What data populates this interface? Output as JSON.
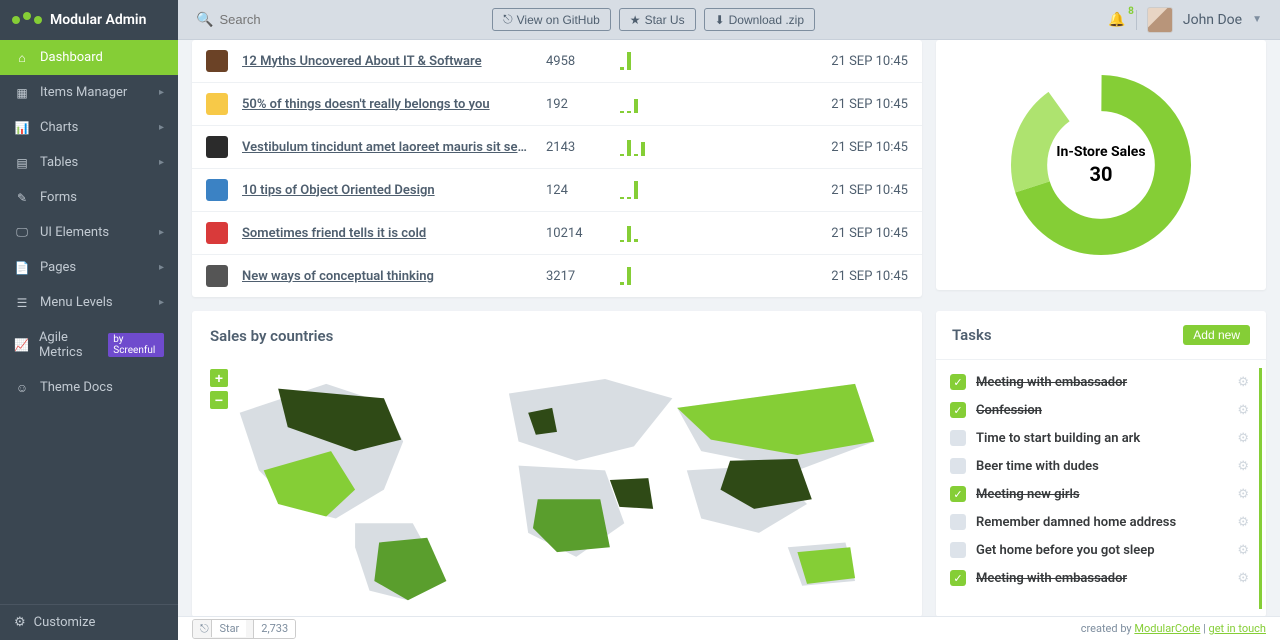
{
  "brand": "Modular Admin",
  "search_placeholder": "Search",
  "header_buttons": {
    "github": "View on GitHub",
    "star": "Star Us",
    "download": "Download .zip"
  },
  "notifications_count": "8",
  "user_name": "John Doe",
  "sidebar": [
    {
      "label": "Dashboard",
      "icon": "⌂",
      "active": true,
      "arrow": false
    },
    {
      "label": "Items Manager",
      "icon": "▦",
      "arrow": true
    },
    {
      "label": "Charts",
      "icon": "📊",
      "arrow": true
    },
    {
      "label": "Tables",
      "icon": "▤",
      "arrow": true
    },
    {
      "label": "Forms",
      "icon": "✎",
      "arrow": false
    },
    {
      "label": "UI Elements",
      "icon": "🖵",
      "arrow": true
    },
    {
      "label": "Pages",
      "icon": "📄",
      "arrow": true
    },
    {
      "label": "Menu Levels",
      "icon": "☰",
      "arrow": true
    },
    {
      "label": "Agile Metrics",
      "icon": "📈",
      "badge": "by Screenful"
    },
    {
      "label": "Theme Docs",
      "icon": "☺"
    }
  ],
  "customize_label": "Customize",
  "articles": [
    {
      "title": "12 Myths Uncovered About IT & Software",
      "views": "4958",
      "date": "21 SEP 10:45",
      "spark": [
        3,
        18
      ],
      "color": "#6b4226"
    },
    {
      "title": "50% of things doesn't really belongs to you",
      "views": "192",
      "date": "21 SEP 10:45",
      "spark": [
        2,
        2,
        14
      ],
      "color": "#f7c948"
    },
    {
      "title": "Vestibulum tincidunt amet laoreet mauris sit sem aliquam cras",
      "views": "2143",
      "date": "21 SEP 10:45",
      "spark": [
        2,
        16,
        2,
        14
      ],
      "color": "#2b2b2b"
    },
    {
      "title": "10 tips of Object Oriented Design",
      "views": "124",
      "date": "21 SEP 10:45",
      "spark": [
        2,
        2,
        18
      ],
      "color": "#3b82c4"
    },
    {
      "title": "Sometimes friend tells it is cold",
      "views": "10214",
      "date": "21 SEP 10:45",
      "spark": [
        2,
        16,
        3
      ],
      "color": "#d93a3a"
    },
    {
      "title": "New ways of conceptual thinking",
      "views": "3217",
      "date": "21 SEP 10:45",
      "spark": [
        3,
        18
      ],
      "color": "#555"
    }
  ],
  "chart_data": {
    "type": "pie",
    "title": "In-Store Sales",
    "center_value": "30",
    "series": [
      {
        "name": "primary",
        "color": "#85ce36",
        "value": 70
      },
      {
        "name": "light",
        "color": "#aee36f",
        "value": 20
      },
      {
        "name": "gap",
        "color": "#ffffff",
        "value": 10
      }
    ]
  },
  "map_title": "Sales by countries",
  "tasks_title": "Tasks",
  "add_new_label": "Add new",
  "tasks": [
    {
      "text": "Meeting with embassador",
      "done": true
    },
    {
      "text": "Confession",
      "done": true
    },
    {
      "text": "Time to start building an ark",
      "done": false
    },
    {
      "text": "Beer time with dudes",
      "done": false
    },
    {
      "text": "Meeting new girls",
      "done": true
    },
    {
      "text": "Remember damned home address",
      "done": false
    },
    {
      "text": "Get home before you got sleep",
      "done": false
    },
    {
      "text": "Meeting with embassador",
      "done": true
    }
  ],
  "github_star_count": "2,733",
  "github_star_label": "Star",
  "footer_created": "created by ",
  "footer_link1": "ModularCode",
  "footer_sep": " | ",
  "footer_link2": "get in touch"
}
